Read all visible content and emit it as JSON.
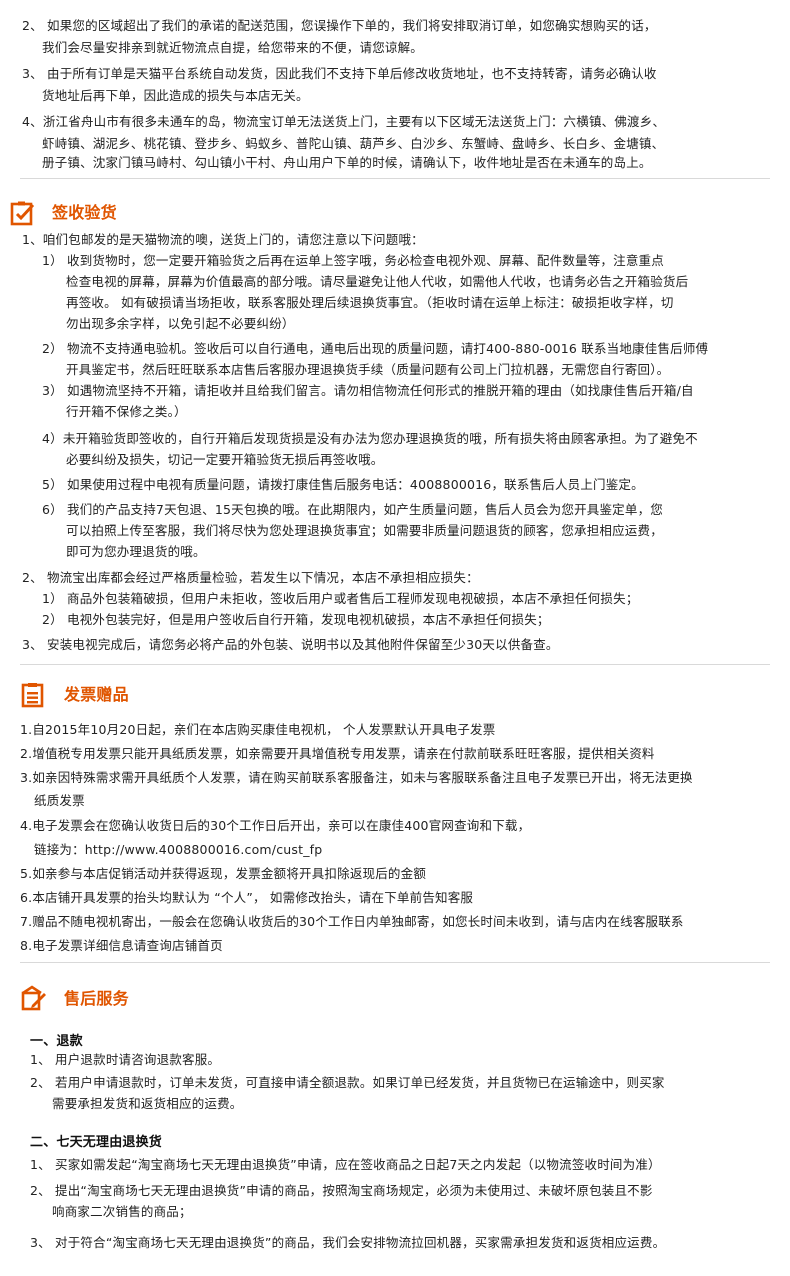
{
  "colors": {
    "accent": "#e05500",
    "text": "#222222",
    "divider": "#d9d9d9"
  },
  "top_notes": [
    "2、 如果您的区域超出了我们的承诺的配送范围，您误操作下单的，我们将安排取消订单，如您确实想购买的话，",
    "我们会尽量安排亲到就近物流点自提，给您带来的不便，请您谅解。",
    "3、 由于所有订单是天猫平台系统自动发货，因此我们不支持下单后修改收货地址，也不支持转寄，请务必确认收",
    "货地址后再下单，因此造成的损失与本店无关。",
    "4、浙江省舟山市有很多未通车的岛，物流宝订单无法送货上门，主要有以下区域无法送货上门：六横镇、佛渡乡、",
    "虾峙镇、湖泥乡、桃花镇、登步乡、蚂蚁乡、普陀山镇、葫芦乡、白沙乡、东蟹峙、盘峙乡、长白乡、金塘镇、",
    "册子镇、沈家门镇马峙村、勾山镇小干村、舟山用户下单的时候，请确认下，收件地址是否在未通车的岛上。"
  ],
  "section_receipt": {
    "title": "签收验货",
    "icon": "clipboard-check-icon",
    "lines": [
      "1、咱们包邮发的是天猫物流的噢，送货上门的，请您注意以下问题哦：",
      "1） 收到货物时，您一定要开箱验货之后再在运单上签字哦，务必检查电视外观、屏幕、配件数量等，注意重点",
      "检查电视的屏幕，屏幕为价值最高的部分哦。请尽量避免让他人代收，如需他人代收，也请务必告之开箱验货后",
      "再签收。 如有破损请当场拒收，联系客服处理后续退换货事宜。（拒收时请在运单上标注：破损拒收字样，切",
      "勿出现多余字样，以免引起不必要纠纷）",
      "2） 物流不支持通电验机。签收后可以自行通电，通电后出现的质量问题，请打400-880-0016 联系当地康佳售后师傅",
      "开具鉴定书，然后旺旺联系本店售后客服办理退换货手续（质量问题有公司上门拉机器，无需您自行寄回）。",
      "3） 如遇物流坚持不开箱，请拒收并且给我们留言。请勿相信物流任何形式的推脱开箱的理由（如找康佳售后开箱/自",
      "行开箱不保修之类。）",
      "4）未开箱验货即签收的，自行开箱后发现货损是没有办法为您办理退换货的哦，所有损失将由顾客承担。为了避免不",
      "必要纠纷及损失，切记一定要开箱验货无损后再签收哦。",
      "5） 如果使用过程中电视有质量问题，请拨打康佳售后服务电话：4008800016，联系售后人员上门鉴定。",
      "6） 我们的产品支持7天包退、15天包换的哦。在此期限内，如产生质量问题，售后人员会为您开具鉴定单，您",
      "可以拍照上传至客服，我们将尽快为您处理退换货事宜；如需要非质量问题退货的顾客，您承担相应运费，",
      "即可为您办理退货的哦。",
      "2、 物流宝出库都会经过严格质量检验，若发生以下情况，本店不承担相应损失：",
      "1） 商品外包装箱破损，但用户未拒收，签收后用户或者售后工程师发现电视破损，本店不承担任何损失；",
      "2） 电视外包装完好，但是用户签收后自行开箱，发现电视机破损，本店不承担任何损失；",
      "3、 安装电视完成后，请您务必将产品的外包装、说明书以及其他附件保留至少30天以供备查。"
    ]
  },
  "section_invoice": {
    "title": "发票赠品",
    "icon": "document-list-icon",
    "lines": [
      "1.自2015年10月20日起，亲们在本店购买康佳电视机， 个人发票默认开具电子发票",
      "2.增值税专用发票只能开具纸质发票，如亲需要开具增值税专用发票，请亲在付款前联系旺旺客服，提供相关资料",
      "3.如亲因特殊需求需开具纸质个人发票，请在购买前联系客服备注，如未与客服联系备注且电子发票已开出，将无法更换",
      "纸质发票",
      "4.电子发票会在您确认收货日后的30个工作日后开出，亲可以在康佳400官网查询和下载，",
      "链接为：http://www.4008800016.com/cust_fp",
      "5.如亲参与本店促销活动并获得返现，发票金额将开具扣除返现后的金额",
      "6.本店铺开具发票的抬头均默认为 “个人”， 如需修改抬头，请在下单前告知客服",
      "7.赠品不随电视机寄出，一般会在您确认收货后的30个工作日内单独邮寄，如您长时间未收到，请与店内在线客服联系",
      "8.电子发票详细信息请查询店铺首页"
    ]
  },
  "section_aftersale": {
    "title": "售后服务",
    "icon": "edit-note-icon",
    "refund_title": "一、退款",
    "refund_lines": [
      "1、 用户退款时请咨询退款客服。",
      "2、 若用户申请退款时，订单未发货，可直接申请全额退款。如果订单已经发货，并且货物已在运输途中，则买家",
      "需要承担发货和返货相应的运费。"
    ],
    "return_title": "二、七天无理由退换货",
    "return_lines": [
      "1、 买家如需发起“淘宝商场七天无理由退换货”申请，应在签收商品之日起7天之内发起（以物流签收时间为准）",
      "2、 提出“淘宝商场七天无理由退换货”申请的商品，按照淘宝商场规定，必须为未使用过、未破坏原包装且不影",
      "响商家二次销售的商品；",
      "3、 对于符合“淘宝商场七天无理由退换货”的商品，我们会安排物流拉回机器，买家需承担发货和返货相应运费。"
    ]
  }
}
